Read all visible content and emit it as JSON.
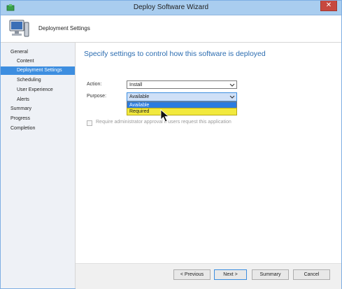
{
  "window": {
    "title": "Deploy Software Wizard",
    "close_glyph": "✕"
  },
  "header": {
    "page_title": "Deployment Settings",
    "icon": "computer-icon"
  },
  "nav": {
    "items": [
      {
        "label": "General"
      },
      {
        "label": "Content"
      },
      {
        "label": "Deployment Settings"
      },
      {
        "label": "Scheduling"
      },
      {
        "label": "User Experience"
      },
      {
        "label": "Alerts"
      },
      {
        "label": "Summary"
      },
      {
        "label": "Progress"
      },
      {
        "label": "Completion"
      }
    ]
  },
  "main": {
    "heading": "Specify settings to control how this software is deployed",
    "action": {
      "label": "Action:",
      "value": "Install"
    },
    "purpose": {
      "label": "Purpose:",
      "value": "Available",
      "options": [
        "Available",
        "Required"
      ]
    },
    "require_approval": {
      "label": "Require administrator approval if users request this application",
      "checked": false
    }
  },
  "footer": {
    "previous": "< Previous",
    "next": "Next >",
    "summary": "Summary",
    "cancel": "Cancel"
  },
  "colors": {
    "accent": "#3d8ee0",
    "heading": "#2b6cb0",
    "highlight": "#f2e93d",
    "close": "#c7483f"
  }
}
